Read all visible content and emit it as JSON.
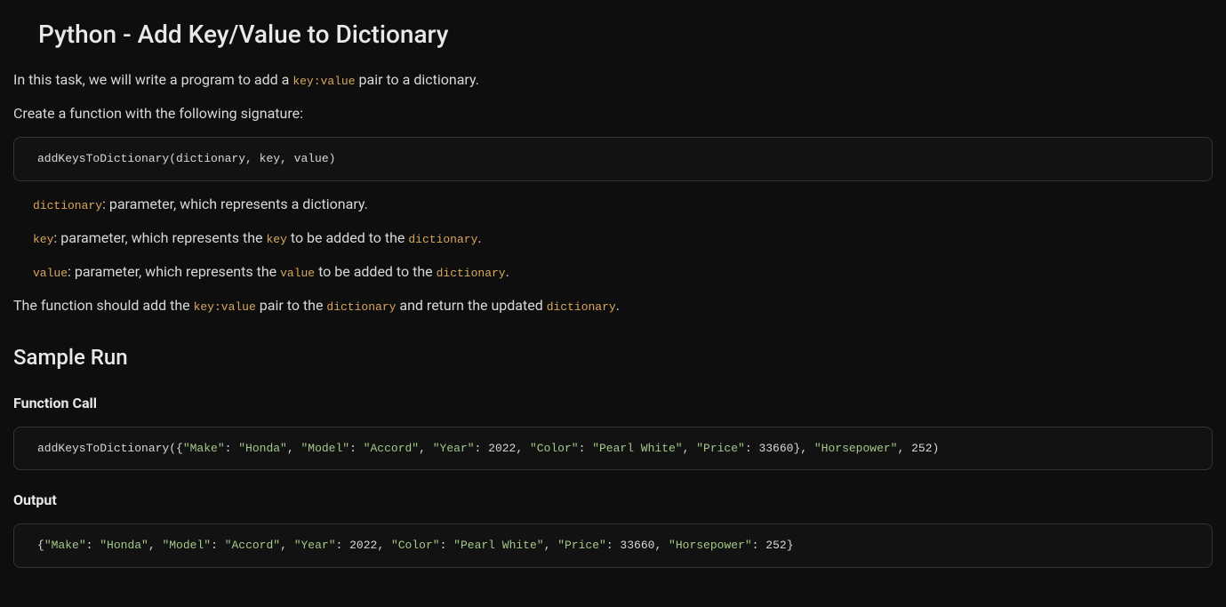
{
  "title": "Python - Add Key/Value to Dictionary",
  "intro": {
    "before": "In this task, we will write a program to add a ",
    "code": "key:value",
    "after": " pair to a dictionary."
  },
  "signature_lead": "Create a function with the following signature:",
  "signature_code": "addKeysToDictionary(dictionary, key, value)",
  "params": {
    "dictionary": {
      "name": "dictionary",
      "desc": ": parameter, which represents a dictionary."
    },
    "key": {
      "name": "key",
      "desc_before": ": parameter, which represents the ",
      "code1": "key",
      "mid": " to be added to the ",
      "code2": "dictionary",
      "after": "."
    },
    "value": {
      "name": "value",
      "desc_before": ": parameter, which represents the ",
      "code1": "value",
      "mid": " to be added to the ",
      "code2": "dictionary",
      "after": "."
    }
  },
  "behavior": {
    "before": "The function should add the ",
    "code1": "key:value",
    "mid1": " pair to the ",
    "code2": "dictionary",
    "mid2": " and return the updated ",
    "code3": "dictionary",
    "after": "."
  },
  "sample_heading": "Sample Run",
  "call_heading": "Function Call",
  "output_heading": "Output",
  "call_code": {
    "fn": "addKeysToDictionary({",
    "pairs": [
      {
        "k": "\"Make\"",
        "v": "\"Honda\""
      },
      {
        "k": "\"Model\"",
        "v": "\"Accord\""
      },
      {
        "k": "\"Year\"",
        "v": "2022",
        "num": true
      },
      {
        "k": "\"Color\"",
        "v": "\"Pearl White\""
      },
      {
        "k": "\"Price\"",
        "v": "33660",
        "num": true
      }
    ],
    "close_dict": "}, ",
    "arg_key": "\"Horsepower\"",
    "sep": ", ",
    "arg_val": "252",
    "close_call": ")"
  },
  "output_code": {
    "open": "{",
    "pairs": [
      {
        "k": "\"Make\"",
        "v": "\"Honda\""
      },
      {
        "k": "\"Model\"",
        "v": "\"Accord\""
      },
      {
        "k": "\"Year\"",
        "v": "2022",
        "num": true
      },
      {
        "k": "\"Color\"",
        "v": "\"Pearl White\""
      },
      {
        "k": "\"Price\"",
        "v": "33660",
        "num": true
      },
      {
        "k": "\"Horsepower\"",
        "v": "252",
        "num": true
      }
    ],
    "close": "}"
  }
}
